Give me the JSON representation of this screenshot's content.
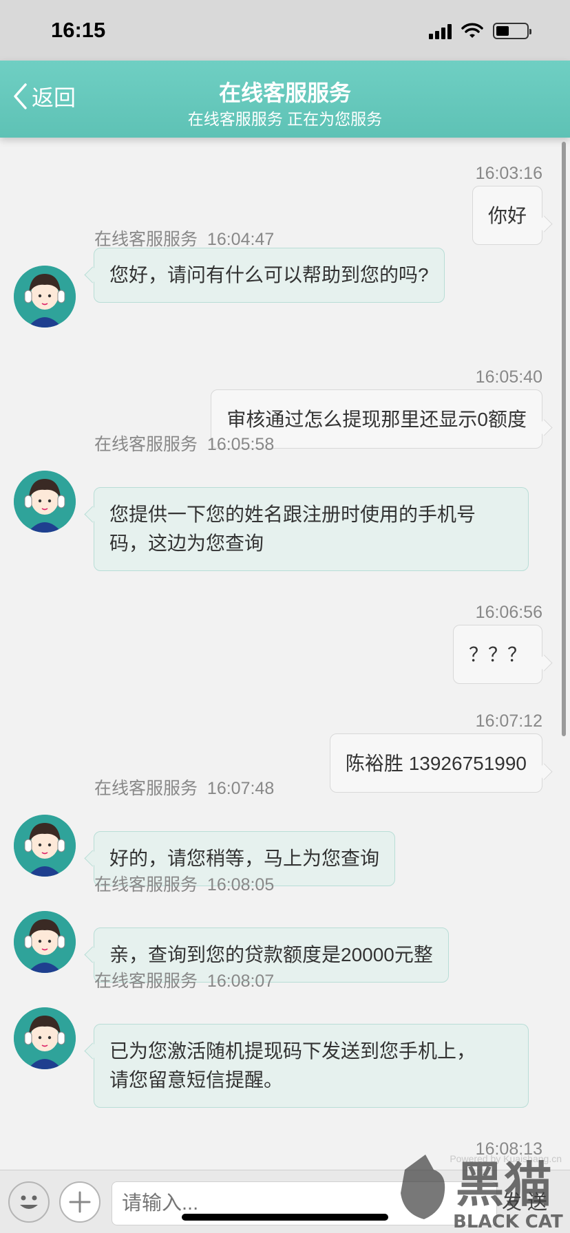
{
  "status_bar": {
    "time": "16:15"
  },
  "header": {
    "back_label": "返回",
    "title": "在线客服服务",
    "subtitle": "在线客服服务 正在为您服务"
  },
  "messages": [
    {
      "side": "right",
      "time": "16:03:16",
      "text": "你好"
    },
    {
      "side": "left",
      "sender": "在线客服服务",
      "time": "16:04:47",
      "text": "您好，请问有什么可以帮助到您的吗?"
    },
    {
      "side": "right",
      "time": "16:05:40",
      "text": "审核通过怎么提现那里还显示0额度"
    },
    {
      "side": "left",
      "sender": "在线客服服务",
      "time": "16:05:58",
      "text_line1": "您提供一下您的姓名跟注册时使用的手机号",
      "text_line2": "码，这边为您查询"
    },
    {
      "side": "right",
      "time": "16:06:56",
      "text": "？？？"
    },
    {
      "side": "right",
      "time": "16:07:12",
      "text": "陈裕胜 13926751990"
    },
    {
      "side": "left",
      "sender": "在线客服服务",
      "time": "16:07:48",
      "text": "好的，请您稍等，马上为您查询"
    },
    {
      "side": "left",
      "sender": "在线客服服务",
      "time": "16:08:05",
      "text": "亲，查询到您的贷款额度是20000元整"
    },
    {
      "side": "left",
      "sender": "在线客服服务",
      "time": "16:08:07",
      "text_line1": "已为您激活随机提现码下发送到您手机上，",
      "text_line2": "请您留意短信提醒。"
    },
    {
      "side": "right",
      "time": "16:08:13"
    }
  ],
  "input_bar": {
    "placeholder": "请输入...",
    "send_label": "发 送",
    "powered_by": "Powered by Kuaishang.cn"
  },
  "watermark": {
    "text_big": "黑猫",
    "text_small": "BLACK CAT"
  },
  "colors": {
    "header": "#5ec2b5",
    "agent_bubble": "#e6f1ee",
    "user_bubble": "#f7f7f7",
    "avatar_bg": "#2fa39a"
  },
  "icons": {
    "back": "chevron-left-icon",
    "emoji": "smile-icon",
    "plus": "plus-icon",
    "signal": "signal-icon",
    "wifi": "wifi-icon",
    "battery": "battery-icon"
  }
}
